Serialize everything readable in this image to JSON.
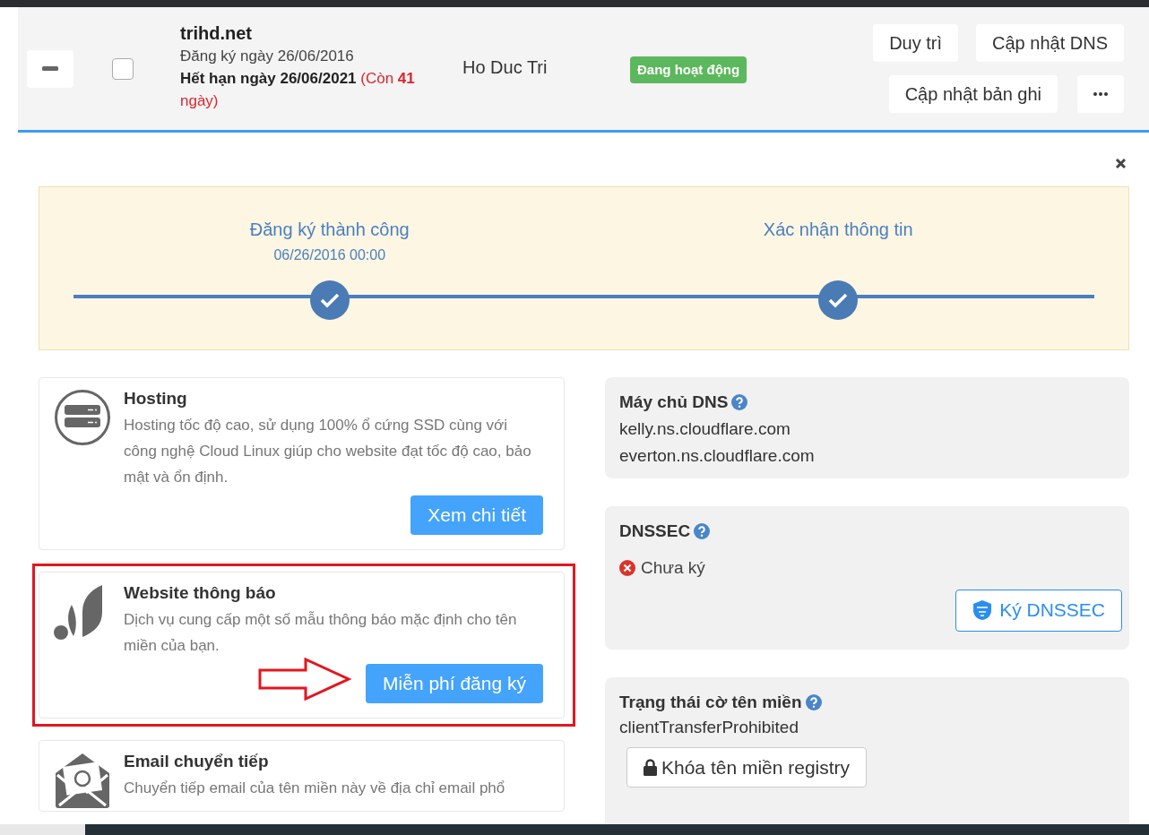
{
  "row": {
    "checked": false,
    "domain": "trihd.net",
    "registered": "Đăng ký ngày 26/06/2016",
    "expiry": "Hết hạn ngày 26/06/2021",
    "remaining": "(Còn **41** ngày)",
    "owner": "Ho Duc Tri",
    "status": {
      "label": "Đang hoạt động",
      "color": "#5cb85c"
    },
    "actions": [
      "Duy trì",
      "Cập nhật DNS",
      "Cập nhật bản ghi"
    ]
  },
  "progress": {
    "steps": [
      {
        "label": "Đăng ký thành công",
        "date": "06/26/2016 00:00",
        "done": true
      },
      {
        "label": "Xác nhận thông tin",
        "done": true
      }
    ]
  },
  "services": [
    {
      "kind": "hosting",
      "title": "Hosting",
      "description": "Hosting tốc độ cao, sử dụng 100% ổ cứng SSD cùng với công nghệ Cloud Linux giúp cho website đạt tốc độ cao, bảo mật và ổn định.",
      "button": "Xem chi tiết",
      "highlighted": false
    },
    {
      "kind": "notice",
      "title": "Website thông báo",
      "description": "Dịch vụ cung cấp một số mẫu thông báo mặc định cho tên miền của bạn.",
      "button": "Miễn phí đăng ký",
      "highlighted": true
    },
    {
      "kind": "email",
      "title": "Email chuyển tiếp",
      "description": "Chuyển tiếp email của tên miền này về địa chỉ email phổ"
    }
  ],
  "dns": {
    "title": "Máy chủ DNS",
    "servers": [
      "kelly.ns.cloudflare.com",
      "everton.ns.cloudflare.com"
    ]
  },
  "dnssec": {
    "title": "DNSSEC",
    "signed": false,
    "status": "Chưa ký",
    "button": "Ký DNSSEC"
  },
  "flags": {
    "title": "Trạng thái cờ tên miền",
    "value": "clientTransferProhibited",
    "buttons": [
      "Khóa tên miền registry"
    ]
  }
}
